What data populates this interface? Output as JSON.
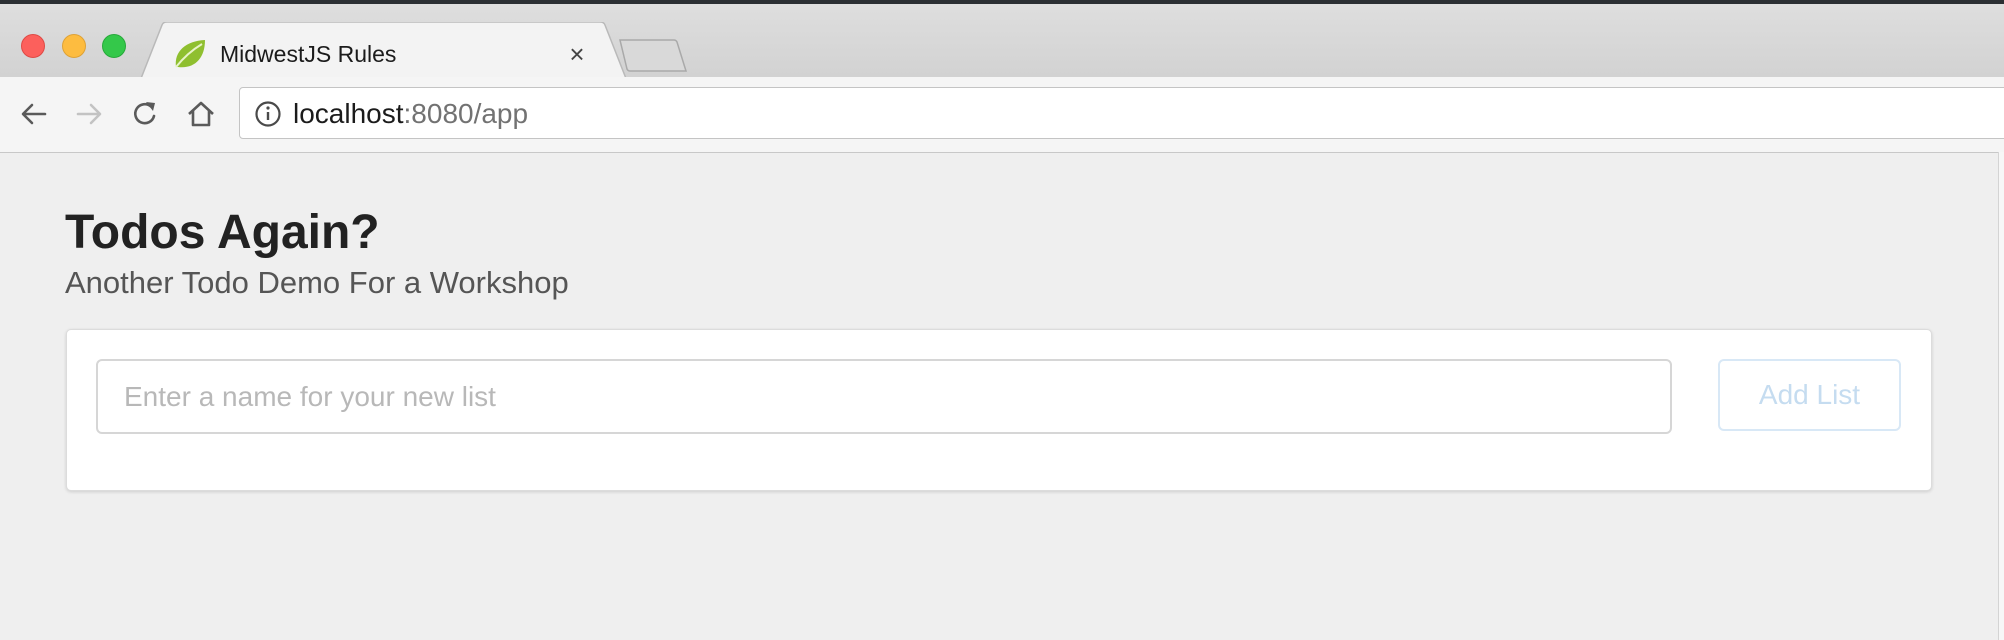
{
  "browser": {
    "tab": {
      "title": "MidwestJS Rules",
      "close_glyph": "×"
    },
    "address": {
      "host": "localhost",
      "path": ":8080/app"
    },
    "icons": [
      "back-arrow-icon",
      "forward-arrow-icon",
      "reload-icon",
      "home-icon",
      "site-info-icon",
      "leaf-favicon-icon"
    ],
    "colors": {
      "close": "#fc605c",
      "minimize": "#fdbc40",
      "maximize": "#34c84a"
    }
  },
  "page": {
    "title": "Todos Again?",
    "subtitle": "Another Todo Demo For a Workshop",
    "new_list": {
      "placeholder": "Enter a name for your new list",
      "value": "",
      "button_label": "Add List",
      "button_disabled": true
    }
  },
  "colors": {
    "background": "#efefef",
    "title": "#222222",
    "button_text": "#c5dcf0"
  }
}
